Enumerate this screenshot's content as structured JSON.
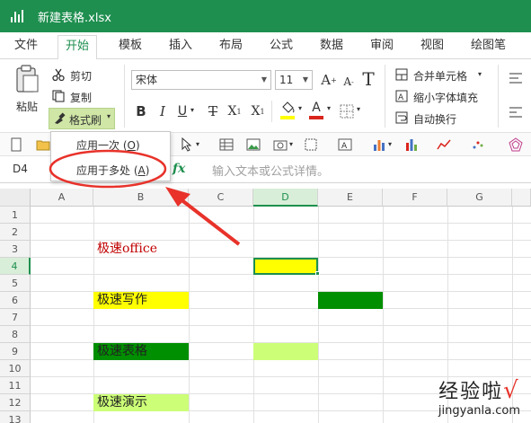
{
  "window": {
    "title": "新建表格.xlsx"
  },
  "menu": {
    "tabs": [
      "文件",
      "开始",
      "模板",
      "插入",
      "布局",
      "公式",
      "数据",
      "审阅",
      "视图",
      "绘图笔"
    ],
    "active_index": 1
  },
  "ribbon": {
    "paste_label": "粘贴",
    "cut_label": "剪切",
    "copy_label": "复制",
    "format_painter_label": "格式刷",
    "font_name": "宋体",
    "font_size": "11",
    "bold": "B",
    "italic": "I",
    "underline": "U",
    "strike": "T",
    "subscript": "X",
    "superscript": "X",
    "merge_label": "合并单元格",
    "shrink_label": "缩小字体填充",
    "wrap_label": "自动换行",
    "font_color": "#d9251c",
    "fill_color": "#ffff00"
  },
  "format_painter_menu": {
    "items": [
      {
        "label": "应用一次",
        "key": "O"
      },
      {
        "label": "应用于多处",
        "key": "A"
      }
    ]
  },
  "formula_bar": {
    "cell_ref": "D4",
    "fx": "fx",
    "placeholder": "输入文本或公式详情。"
  },
  "sheet": {
    "columns": [
      "A",
      "B",
      "C",
      "D",
      "E",
      "F",
      "G"
    ],
    "selected_column": "D",
    "rows": [
      "1",
      "2",
      "3",
      "4",
      "5",
      "6",
      "7",
      "8",
      "9",
      "10",
      "11",
      "12",
      "13"
    ],
    "selected_row": "4",
    "cells": {
      "B3": "极速office",
      "B6": "极速写作",
      "B9": "极速表格",
      "B12": "极速演示"
    },
    "colors": {
      "yellow": "#ffff00",
      "green": "#008f00",
      "light_green": "#ccff77",
      "red_text": "#c00000",
      "accent": "#1e8f4f"
    }
  },
  "watermark": {
    "main": "经验啦",
    "check": "√",
    "url": "jingyanla.com"
  }
}
